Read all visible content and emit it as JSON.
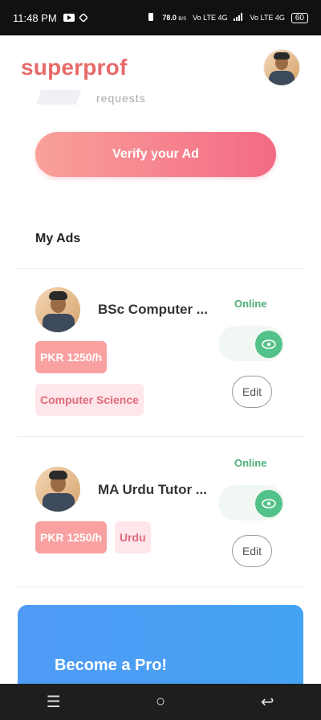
{
  "status_bar": {
    "time": "11:48 PM",
    "speed": "78.0",
    "speed_unit": "B/S",
    "net1": "Vo LTE",
    "net1_type": "4G",
    "net2": "Vo LTE",
    "net2_type": "4G",
    "battery": "60"
  },
  "header": {
    "logo": "superprof",
    "avatar_icon": "profile-avatar"
  },
  "partial_text": "requests",
  "verify_button": "Verify your Ad",
  "my_ads": {
    "title": "My Ads",
    "ads": [
      {
        "title": "BSc Computer ...",
        "status": "Online",
        "price": "PKR 1250/h",
        "subject": "Computer Science",
        "edit_label": "Edit",
        "toggle_on": true
      },
      {
        "title": "MA Urdu Tutor ...",
        "status": "Online",
        "price": "PKR 1250/h",
        "subject": "Urdu",
        "edit_label": "Edit",
        "toggle_on": true
      }
    ]
  },
  "pro_card": {
    "title": "Become a Pro!"
  },
  "nav": {
    "menu_icon": "☰",
    "home_icon": "○",
    "back_icon": "↩"
  },
  "colors": {
    "brand": "#e86a6a",
    "online": "#4caf7a",
    "pro": "#4f9bf5"
  }
}
